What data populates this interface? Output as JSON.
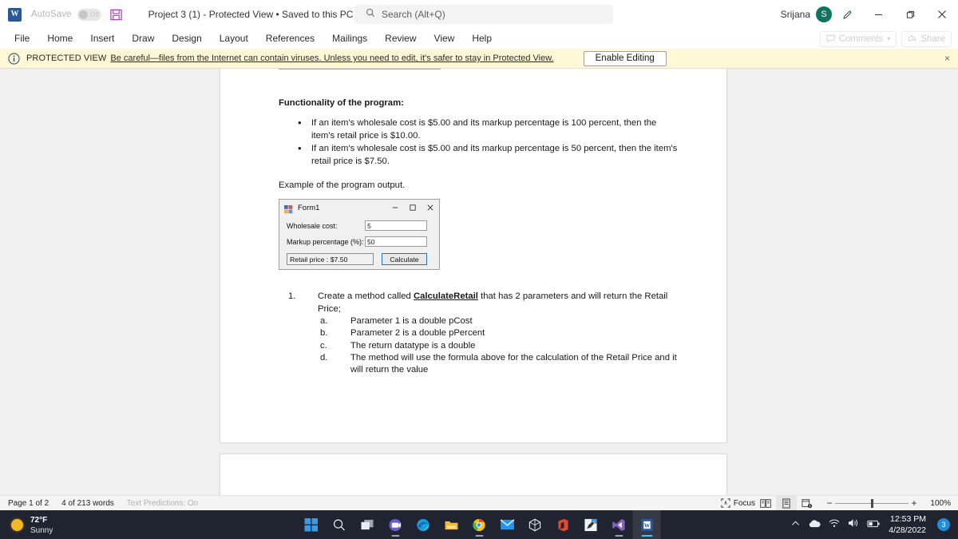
{
  "titlebar": {
    "app_icon": "word-icon",
    "autosave_label": "AutoSave",
    "autosave_state": "Off",
    "save_icon": "save-icon",
    "document_title": "Project 3 (1)  -  Protected View • Saved to this PC",
    "title_caret": "chevron-down-icon",
    "search_placeholder": "Search (Alt+Q)",
    "user_name": "Srijana",
    "user_initial": "S",
    "pen_icon": "pen-icon",
    "minimize": "minimize-icon",
    "restore": "restore-icon",
    "close": "close-icon"
  },
  "ribbon": {
    "tabs": [
      {
        "label": "File"
      },
      {
        "label": "Home"
      },
      {
        "label": "Insert"
      },
      {
        "label": "Draw"
      },
      {
        "label": "Design"
      },
      {
        "label": "Layout"
      },
      {
        "label": "References"
      },
      {
        "label": "Mailings"
      },
      {
        "label": "Review"
      },
      {
        "label": "View"
      },
      {
        "label": "Help"
      }
    ],
    "comments_label": "Comments",
    "share_label": "Share"
  },
  "protected_view": {
    "badge": "PROTECTED VIEW",
    "message": "Be careful—files from the Internet can contain viruses. Unless you need to edit, it's safer to stay in Protected View.",
    "button": "Enable Editing",
    "close": "×",
    "bar_color": "#fff8d6"
  },
  "document": {
    "heading": "Functionality of the program:",
    "bullets": [
      "If an item's wholesale cost is $5.00 and its markup percentage is 100 percent, then the item's retail price is $10.00.",
      "If an item's wholesale cost is $5.00 and its markup percentage is 50 percent, then the item's retail price is $7.50."
    ],
    "example_caption": "Example of the program output.",
    "form": {
      "title": "Form1",
      "minimize": "minimize-icon",
      "maximize": "maximize-icon",
      "close": "close-icon",
      "wholesale_label": "Wholesale cost:",
      "wholesale_value": "5",
      "markup_label": "Markup percentage (%):",
      "markup_value": "50",
      "result_text": "Retail price : $7.50",
      "calculate_label": "Calculate"
    },
    "numbered": {
      "marker": "1.",
      "text_before": "Create a method called ",
      "method_name": "CalculateRetail",
      "text_after": " that has 2 parameters and will return the Retail Price;",
      "sub_items": [
        {
          "marker": "a.",
          "text": "Parameter 1 is a double pCost"
        },
        {
          "marker": "b.",
          "text": "Parameter 2 is a double pPercent"
        },
        {
          "marker": "c.",
          "text": "The return datatype is a double"
        },
        {
          "marker": "d.",
          "text": "The method will use the formula above for the calculation of the Retail Price and it will return the value"
        }
      ]
    }
  },
  "statusbar": {
    "page_info": "Page 1 of 2",
    "word_count": "4 of 213 words",
    "text_predictions": "Text Predictions: On",
    "focus_label": "Focus",
    "view_read": "read-mode-icon",
    "view_print": "print-layout-icon",
    "view_web": "web-layout-icon",
    "zoom_out": "−",
    "zoom_in": "+",
    "zoom_level": "100%"
  },
  "taskbar": {
    "weather_temp": "72°F",
    "weather_cond": "Sunny",
    "apps": [
      {
        "name": "start-button"
      },
      {
        "name": "search-taskbar-icon"
      },
      {
        "name": "task-view-icon"
      },
      {
        "name": "teams-icon"
      },
      {
        "name": "edge-icon"
      },
      {
        "name": "file-explorer-icon"
      },
      {
        "name": "chrome-icon"
      },
      {
        "name": "mail-icon"
      },
      {
        "name": "3d-viewer-icon"
      },
      {
        "name": "office-icon"
      },
      {
        "name": "snip-sketch-icon"
      },
      {
        "name": "visual-studio-icon"
      },
      {
        "name": "word-taskbar-icon"
      }
    ],
    "tray": {
      "chevron": "show-hidden-icons",
      "onedrive": "onedrive-icon",
      "wifi": "wifi-icon",
      "volume": "volume-icon",
      "battery": "battery-icon"
    },
    "time": "12:53 PM",
    "date": "4/28/2022",
    "notification_count": "3"
  }
}
